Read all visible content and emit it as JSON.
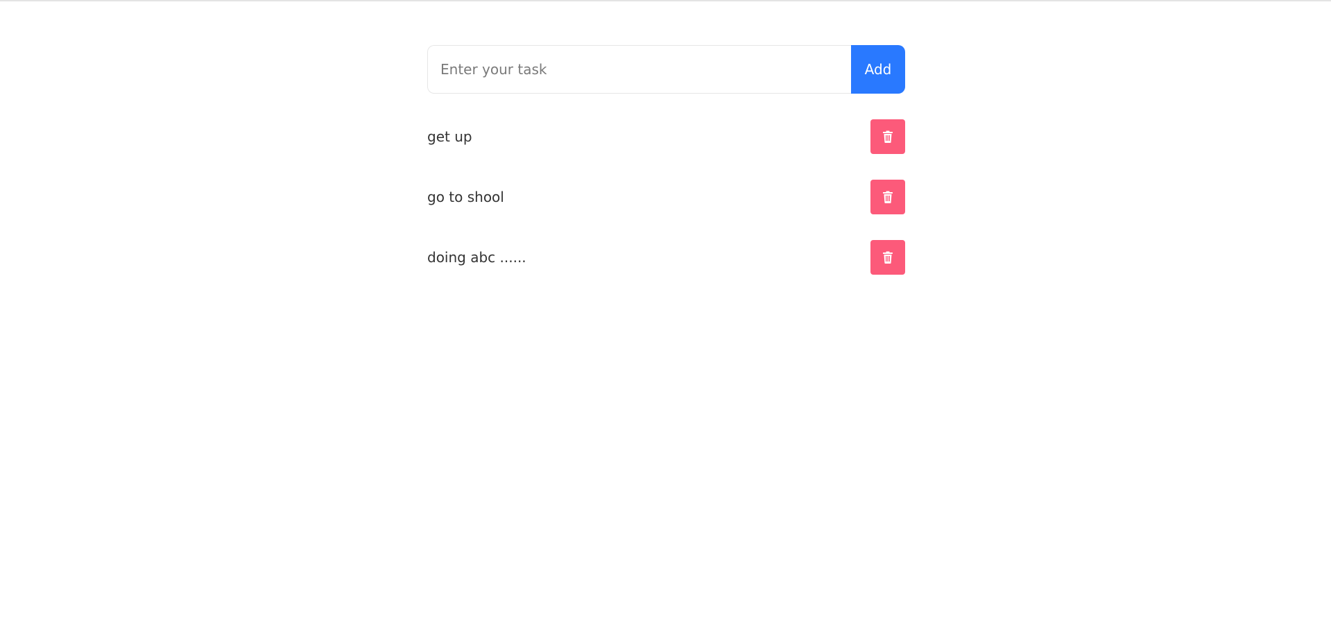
{
  "form": {
    "input_value": "",
    "input_placeholder": "Enter your task",
    "add_label": "Add"
  },
  "tasks": [
    {
      "text": "get up",
      "delete_icon": "trash-icon"
    },
    {
      "text": "go to shool",
      "delete_icon": "trash-icon"
    },
    {
      "text": "doing abc ......",
      "delete_icon": "trash-icon"
    }
  ],
  "colors": {
    "add_button": "#2979ff",
    "delete_button": "#fc5a7a",
    "task_text": "#333333"
  }
}
